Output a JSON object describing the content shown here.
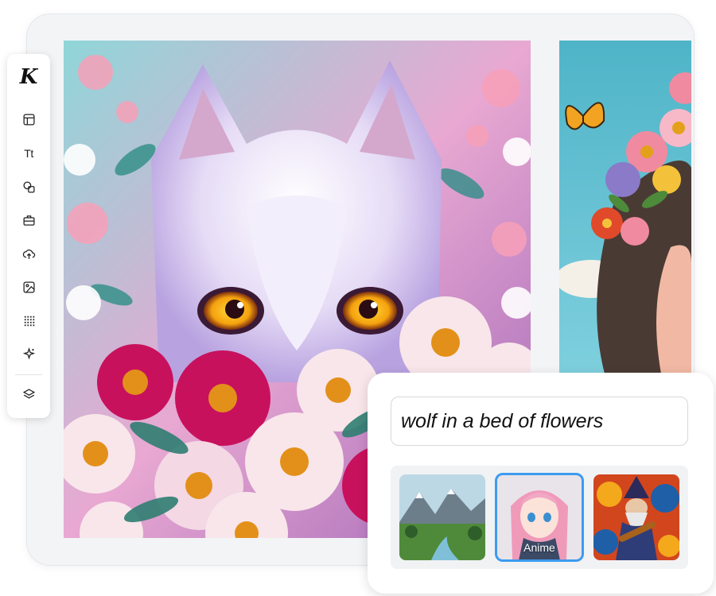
{
  "app": {
    "logo_letter": "K"
  },
  "toolbar": {
    "items": [
      {
        "name": "layout-icon"
      },
      {
        "name": "text-icon",
        "label": "Tt"
      },
      {
        "name": "shapes-icon"
      },
      {
        "name": "briefcase-icon"
      },
      {
        "name": "upload-icon"
      },
      {
        "name": "image-icon"
      },
      {
        "name": "pattern-icon"
      },
      {
        "name": "sparkle-icon"
      },
      {
        "name": "layers-icon"
      }
    ]
  },
  "prompt": {
    "value": "wolf in a bed of flowers"
  },
  "styles": [
    {
      "name": "landscape",
      "label": ""
    },
    {
      "name": "anime",
      "label": "Anime",
      "selected": true
    },
    {
      "name": "psychedelic-wizard",
      "label": ""
    }
  ],
  "colors": {
    "accent": "#3d9bf0",
    "card_bg": "#f3f4f6"
  }
}
